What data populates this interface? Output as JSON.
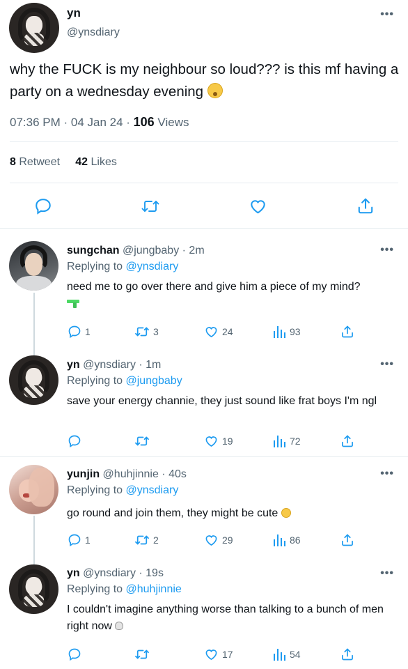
{
  "main_tweet": {
    "author_name": "yn",
    "author_handle": "@ynsdiary",
    "text": "why the FUCK is my neighbour so loud??? is this mf having a party on a wednesday evening",
    "emoji": "dizzy-face-icon",
    "time": "07:36 PM · 04 Jan 24 · ",
    "views_count": "106",
    "views_label": " Views",
    "retweet_count": "8",
    "retweet_label": " Retweet",
    "likes_count": "42",
    "likes_label": " Likes",
    "more": "•••"
  },
  "replies": [
    {
      "name": "sungchan",
      "handle_time": " @jungbaby · 2m",
      "replying_prefix": "Replying to ",
      "replying_to": "@ynsdiary",
      "text": "need me to go over there and give him a piece of my mind?",
      "emoji": "water-pistol-icon",
      "comments": "1",
      "retweets": "3",
      "likes": "24",
      "views": "93",
      "more": "•••"
    },
    {
      "name": "yn",
      "handle_time": " @ynsdiary · 1m",
      "replying_prefix": "Replying to ",
      "replying_to": "@jungbaby",
      "text": "save your energy channie, they just sound like frat boys I'm ngl",
      "comments": "",
      "retweets": "",
      "likes": "19",
      "views": "72",
      "more": "•••"
    },
    {
      "name": "yunjin",
      "handle_time": " @huhjinnie · 40s",
      "replying_prefix": "Replying to ",
      "replying_to": "@ynsdiary",
      "text": "go round and join them, they might be cute",
      "emoji": "smirking-face-icon",
      "comments": "1",
      "retweets": "2",
      "likes": "29",
      "views": "86",
      "more": "•••"
    },
    {
      "name": "yn",
      "handle_time": " @ynsdiary · 19s",
      "replying_prefix": "Replying to ",
      "replying_to": "@huhjinnie",
      "text": "I couldn't imagine anything worse than talking to a bunch of men right now",
      "emoji": "skull-icon",
      "comments": "",
      "retweets": "",
      "likes": "17",
      "views": "54",
      "more": "•••"
    }
  ],
  "colors": {
    "accent": "#1d9bf0",
    "secondary_text": "#536471",
    "divider": "#e6ecf0"
  }
}
